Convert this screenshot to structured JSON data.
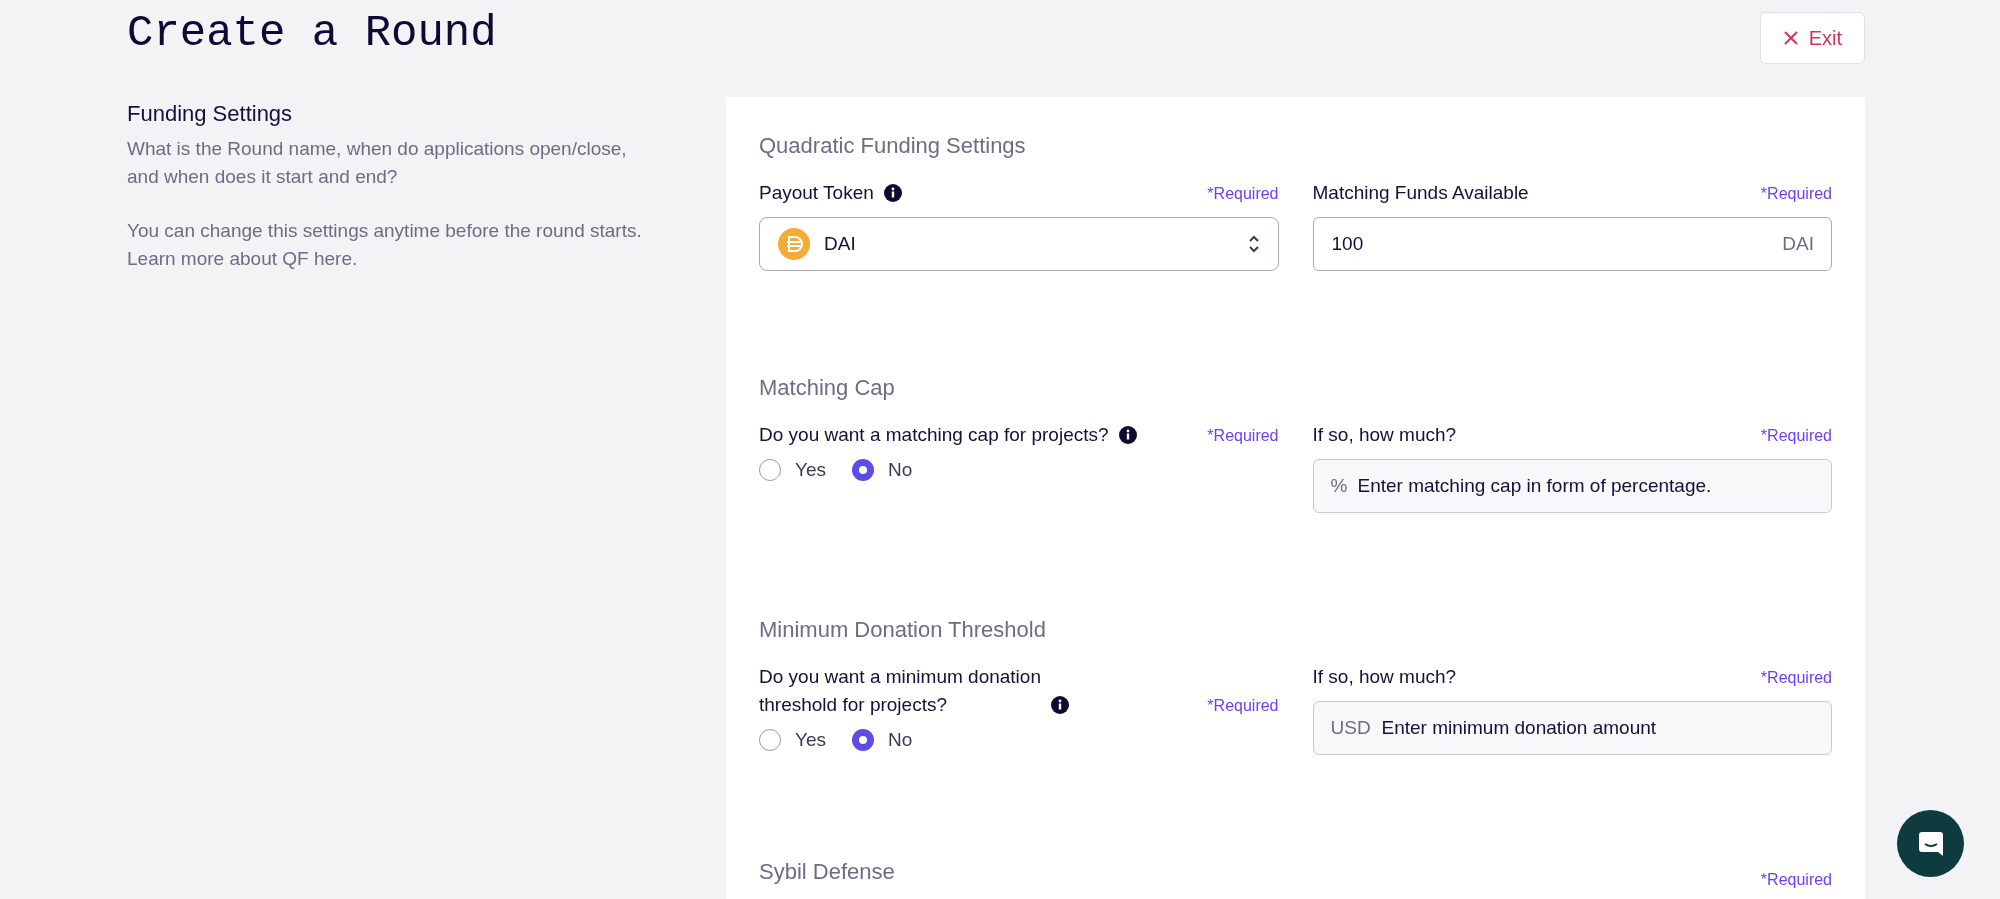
{
  "page": {
    "title": "Create a Round",
    "exit_button": "Exit"
  },
  "intro": {
    "heading": "Funding Settings",
    "paragraphs": [
      "What is the Round name, when do applications open/close, and when does it start and end?",
      "You can change this settings anytime before the round starts. Learn more about QF here."
    ]
  },
  "sections": [
    {
      "title": "Quadratic Funding Settings",
      "fields": [
        {
          "kind": "select",
          "label": "Payout Token",
          "info": true,
          "required": "*Required",
          "value": "DAI"
        },
        {
          "kind": "input",
          "label": "Matching Funds Available",
          "info": false,
          "required": "*Required",
          "value": "100",
          "suffix": "DAI",
          "disabled": false
        }
      ]
    },
    {
      "title": "Matching Cap",
      "fields": [
        {
          "kind": "radio",
          "label": "Do you want a matching cap for projects?",
          "info": true,
          "required": "*Required",
          "options": [
            {
              "label": "Yes",
              "selected": false
            },
            {
              "label": "No",
              "selected": true
            }
          ]
        },
        {
          "kind": "input",
          "label": "If so, how much?",
          "info": false,
          "required": "*Required",
          "prefix": "%",
          "placeholder": "Enter matching cap in form of percentage.",
          "disabled": true
        }
      ]
    },
    {
      "title": "Minimum Donation Threshold",
      "fields": [
        {
          "kind": "radio",
          "label": "Do you want a minimum donation\nthreshold for projects?",
          "info": true,
          "required": "*Required",
          "options": [
            {
              "label": "Yes",
              "selected": false
            },
            {
              "label": "No",
              "selected": true
            }
          ]
        },
        {
          "kind": "input",
          "label": "If so, how much?",
          "info": false,
          "required": "*Required",
          "prefix": "USD",
          "placeholder": "Enter minimum donation amount",
          "disabled": true
        }
      ]
    },
    {
      "title": "Sybil Defense",
      "required": "*Required"
    }
  ]
}
